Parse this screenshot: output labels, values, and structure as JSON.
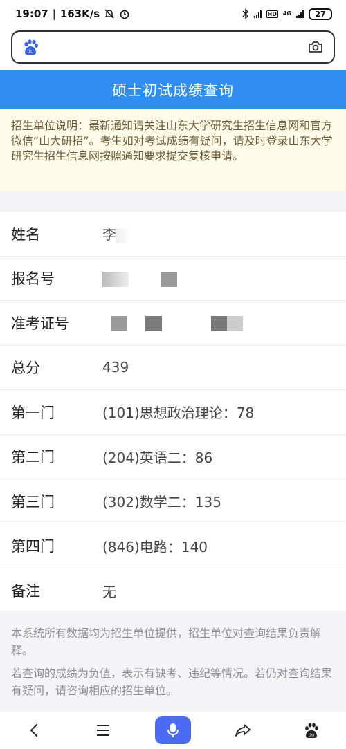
{
  "status_bar": {
    "time": "19:07",
    "speed": "163K/s",
    "hd_label": "HD",
    "net_label": "4G",
    "battery": "27"
  },
  "browser": {
    "logo_text": "du",
    "url_placeholder": ""
  },
  "page": {
    "title": "硕士初试成绩查询",
    "notice": "招生单位说明：最新通知请关注山东大学研究生招生信息网和官方微信“山大研招”。考生如对考试成绩有疑问，请及时登录山东大学研究生招生信息网按照通知要求提交复核申请。"
  },
  "results": [
    {
      "label": "姓名",
      "value": "李"
    },
    {
      "label": "报名号",
      "value": ""
    },
    {
      "label": "准考证号",
      "value": ""
    },
    {
      "label": "总分",
      "value": "439"
    },
    {
      "label": "第一门",
      "value": "(101)思想政治理论：78"
    },
    {
      "label": "第二门",
      "value": "(204)英语二：86"
    },
    {
      "label": "第三门",
      "value": "(302)数学二：135"
    },
    {
      "label": "第四门",
      "value": "(846)电路：140"
    },
    {
      "label": "备注",
      "value": "无"
    }
  ],
  "footer": {
    "note1": "本系统所有数据均为招生单位提供，招生单位对查询结果负责解释。",
    "note2": "若查询的成绩为负值，表示有缺考、违纪等情况。若仍对查询结果有疑问，请咨询相应的招生单位。"
  },
  "colors": {
    "header_bg": "#2f8ef0",
    "notice_bg": "#fefbe9",
    "mic_bg": "#4b6cf2"
  }
}
